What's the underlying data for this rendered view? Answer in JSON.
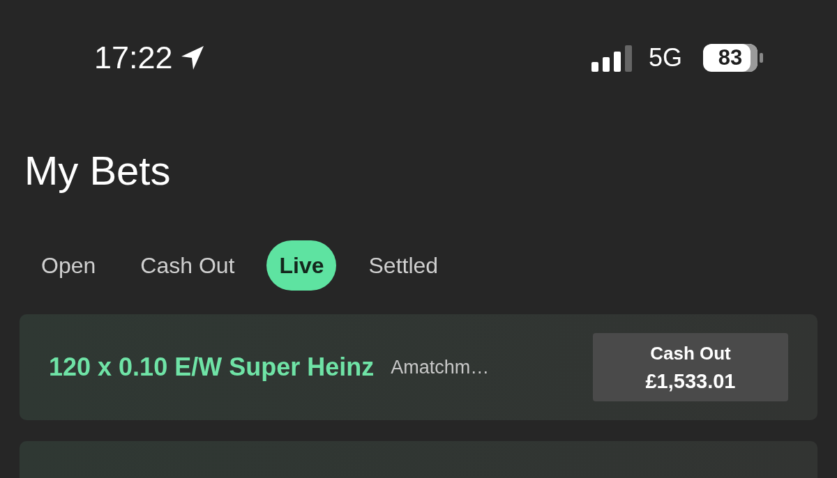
{
  "status_bar": {
    "time": "17:22",
    "network": "5G",
    "battery": "83"
  },
  "title": "My Bets",
  "tabs": [
    {
      "label": "Open",
      "selected": false
    },
    {
      "label": "Cash Out",
      "selected": false
    },
    {
      "label": "Live",
      "selected": true
    },
    {
      "label": "Settled",
      "selected": false
    }
  ],
  "bets": [
    {
      "kind": "bet",
      "name": "120 x 0.10 E/W Super Heinz",
      "event": "Amatchm…",
      "cash_out_label": "Cash Out",
      "cash_out_amount": "£1,533.01"
    },
    {
      "kind": "partial"
    }
  ]
}
